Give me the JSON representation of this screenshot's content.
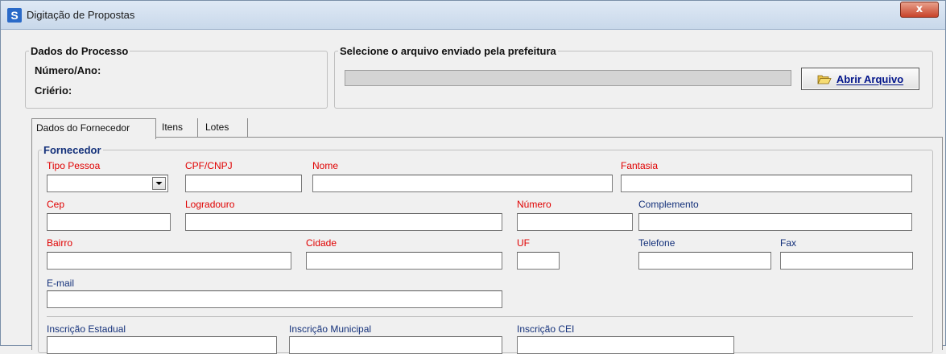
{
  "window": {
    "title": "Digitação de Propostas",
    "close_glyph": "x"
  },
  "processo": {
    "legend": "Dados do Processo",
    "numero_label": "Número/Ano:",
    "criterio_label": "Criério:"
  },
  "arquivo": {
    "legend": "Selecione o arquivo enviado pela prefeitura",
    "path_value": "",
    "button_label": "Abrir Arquivo",
    "button_icon": "folder-open-icon"
  },
  "tabs": [
    "Dados do Fornecedor",
    "Itens",
    "Lotes"
  ],
  "fornecedor": {
    "legend": "Fornecedor",
    "fields": {
      "tipo_pessoa": {
        "label": "Tipo Pessoa",
        "value": ""
      },
      "cpf_cnpj": {
        "label": "CPF/CNPJ",
        "value": ""
      },
      "nome": {
        "label": "Nome",
        "value": ""
      },
      "fantasia": {
        "label": "Fantasia",
        "value": ""
      },
      "cep": {
        "label": "Cep",
        "value": ""
      },
      "logradouro": {
        "label": "Logradouro",
        "value": ""
      },
      "numero": {
        "label": "Número",
        "value": ""
      },
      "complemento": {
        "label": "Complemento",
        "value": ""
      },
      "bairro": {
        "label": "Bairro",
        "value": ""
      },
      "cidade": {
        "label": "Cidade",
        "value": ""
      },
      "uf": {
        "label": "UF",
        "value": ""
      },
      "telefone": {
        "label": "Telefone",
        "value": ""
      },
      "fax": {
        "label": "Fax",
        "value": ""
      },
      "email": {
        "label": "E-mail",
        "value": ""
      },
      "inscricao_estadual": {
        "label": "Inscrição Estadual",
        "value": ""
      },
      "inscricao_municipal": {
        "label": "Inscrição Municipal",
        "value": ""
      },
      "inscricao_cei": {
        "label": "Inscrição CEI",
        "value": ""
      }
    }
  },
  "colors": {
    "required_label": "#e00000",
    "optional_label": "#13307a",
    "button_text": "#00138a"
  }
}
